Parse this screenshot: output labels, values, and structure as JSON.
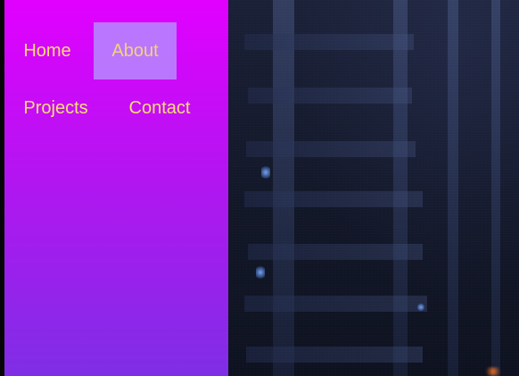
{
  "nav": {
    "items": [
      {
        "label": "Home",
        "active": false
      },
      {
        "label": "About",
        "active": true
      },
      {
        "label": "Projects",
        "active": false
      },
      {
        "label": "Contact",
        "active": false
      }
    ]
  },
  "theme": {
    "sidebar_gradient_top": "#e100ff",
    "sidebar_gradient_bottom": "#7f2ee6",
    "nav_text_color": "#f6de72",
    "active_item_bg": "#b97dff"
  }
}
